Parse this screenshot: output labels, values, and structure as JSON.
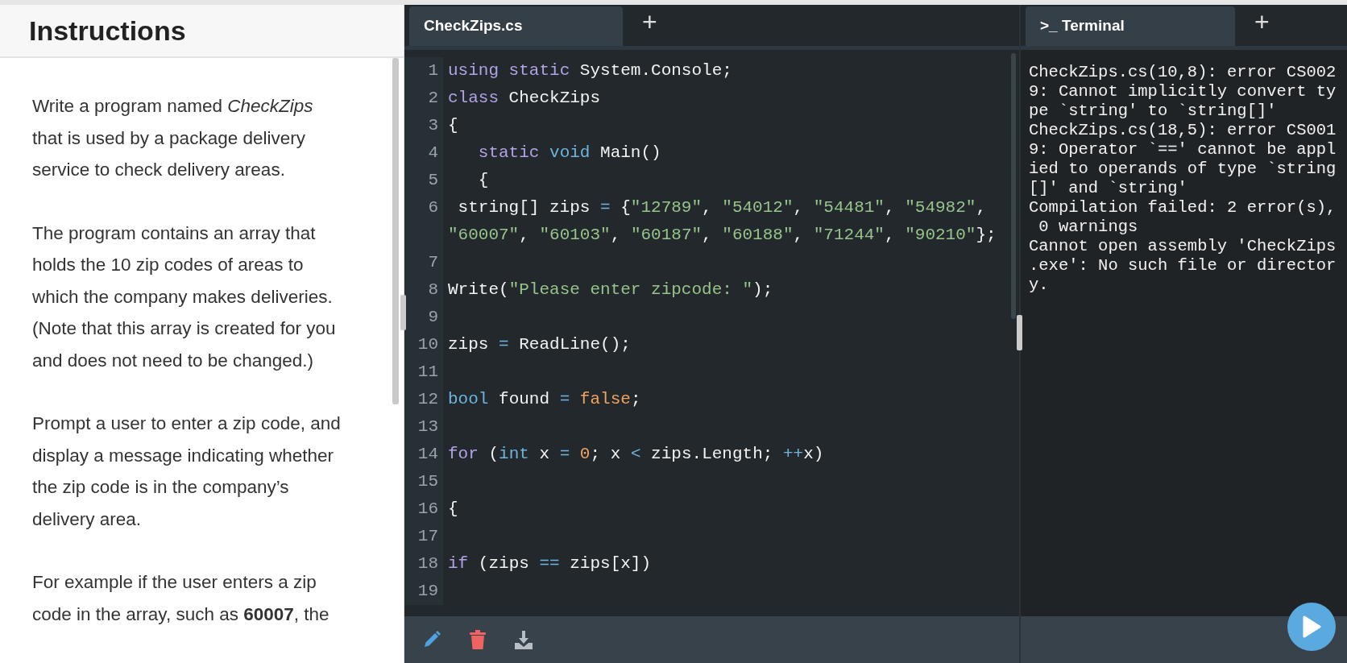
{
  "instructions": {
    "title": "Instructions",
    "paragraphs": [
      "Write a program named *CheckZips* that is used by a package delivery service to check delivery areas.",
      "The program contains an array that holds the 10 zip codes of areas to which the company makes deliveries. (Note that this array is created for you and does not need to be changed.)",
      "Prompt a user to enter a zip code, and display a message indicating whether the zip code is in the company’s delivery area.",
      "For example if the user enters a zip code in the array, such as **60007**, the"
    ]
  },
  "editor": {
    "tabs": [
      {
        "label": "CheckZips.cs",
        "selected": true
      }
    ],
    "add_tab": "+",
    "lines": [
      {
        "number": "1",
        "tokens": [
          {
            "kind": "kw",
            "text": "using"
          },
          {
            "kind": "kw",
            "text": " static"
          },
          {
            "kind": "plain",
            "text": " System.Console;"
          }
        ]
      },
      {
        "number": "2",
        "tokens": [
          {
            "kind": "kw",
            "text": "class"
          },
          {
            "kind": "plain",
            "text": " CheckZips"
          }
        ]
      },
      {
        "number": "3",
        "tokens": [
          {
            "kind": "plain",
            "text": "{"
          }
        ]
      },
      {
        "number": "4",
        "tokens": [
          {
            "kind": "kw",
            "text": "   static"
          },
          {
            "kind": "type",
            "text": " void"
          },
          {
            "kind": "plain",
            "text": " Main()"
          }
        ]
      },
      {
        "number": "5",
        "tokens": [
          {
            "kind": "plain",
            "text": "   {"
          }
        ]
      },
      {
        "number": "6",
        "tokens": [
          {
            "kind": "plain",
            "text": " string[] zips "
          },
          {
            "kind": "op",
            "text": "="
          },
          {
            "kind": "plain",
            "text": " {"
          },
          {
            "kind": "str",
            "text": "\"12789\""
          },
          {
            "kind": "plain",
            "text": ", "
          },
          {
            "kind": "str",
            "text": "\"54012\""
          },
          {
            "kind": "plain",
            "text": ", "
          },
          {
            "kind": "str",
            "text": "\"54481\""
          },
          {
            "kind": "plain",
            "text": ", "
          },
          {
            "kind": "str",
            "text": "\"54982\""
          },
          {
            "kind": "plain",
            "text": ","
          }
        ]
      },
      {
        "tokens": [
          {
            "kind": "str",
            "text": "\"60007\""
          },
          {
            "kind": "plain",
            "text": ", "
          },
          {
            "kind": "str",
            "text": "\"60103\""
          },
          {
            "kind": "plain",
            "text": ", "
          },
          {
            "kind": "str",
            "text": "\"60187\""
          },
          {
            "kind": "plain",
            "text": ", "
          },
          {
            "kind": "str",
            "text": "\"60188\""
          },
          {
            "kind": "plain",
            "text": ", "
          },
          {
            "kind": "str",
            "text": "\"71244\""
          },
          {
            "kind": "plain",
            "text": ", "
          },
          {
            "kind": "str",
            "text": "\"90210\""
          },
          {
            "kind": "plain",
            "text": "};"
          }
        ]
      },
      {
        "number": "7"
      },
      {
        "number": "8",
        "tokens": [
          {
            "kind": "plain",
            "text": "Write("
          },
          {
            "kind": "str",
            "text": "\"Please enter zipcode: \""
          },
          {
            "kind": "plain",
            "text": ");"
          }
        ]
      },
      {
        "number": "9"
      },
      {
        "number": "10",
        "tokens": [
          {
            "kind": "plain",
            "text": "zips "
          },
          {
            "kind": "op",
            "text": "="
          },
          {
            "kind": "plain",
            "text": " ReadLine();"
          }
        ]
      },
      {
        "number": "11"
      },
      {
        "number": "12",
        "tokens": [
          {
            "kind": "type",
            "text": "bool"
          },
          {
            "kind": "plain",
            "text": " found "
          },
          {
            "kind": "op",
            "text": "="
          },
          {
            "kind": "num",
            "text": " false"
          },
          {
            "kind": "plain",
            "text": ";"
          }
        ]
      },
      {
        "number": "13"
      },
      {
        "number": "14",
        "tokens": [
          {
            "kind": "kw",
            "text": "for"
          },
          {
            "kind": "plain",
            "text": " ("
          },
          {
            "kind": "type",
            "text": "int"
          },
          {
            "kind": "plain",
            "text": " x "
          },
          {
            "kind": "op",
            "text": "="
          },
          {
            "kind": "num",
            "text": " 0"
          },
          {
            "kind": "plain",
            "text": "; x "
          },
          {
            "kind": "op",
            "text": "<"
          },
          {
            "kind": "plain",
            "text": " zips.Length; "
          },
          {
            "kind": "op",
            "text": "++"
          },
          {
            "kind": "plain",
            "text": "x)"
          }
        ]
      },
      {
        "number": "15"
      },
      {
        "number": "16",
        "tokens": [
          {
            "kind": "plain",
            "text": "{"
          }
        ]
      },
      {
        "number": "17"
      },
      {
        "number": "18",
        "tokens": [
          {
            "kind": "kw",
            "text": "if"
          },
          {
            "kind": "plain",
            "text": " (zips "
          },
          {
            "kind": "op",
            "text": "=="
          },
          {
            "kind": "plain",
            "text": " zips[x])"
          }
        ]
      },
      {
        "number": "19"
      }
    ]
  },
  "terminal": {
    "tabs": [
      {
        "icon": ">_",
        "label": "Terminal",
        "selected": true
      }
    ],
    "add_tab": "+",
    "output": [
      "CheckZips.cs(10,8): error CS002",
      "9: Cannot implicitly convert ty",
      "pe `string' to `string[]'",
      "CheckZips.cs(18,5): error CS001",
      "9: Operator `==' cannot be appl",
      "ied to operands of type `string",
      "[]' and `string'",
      "Compilation failed: 2 error(s),",
      " 0 warnings",
      "Cannot open assembly 'CheckZips",
      ".exe': No such file or director",
      "y."
    ]
  }
}
